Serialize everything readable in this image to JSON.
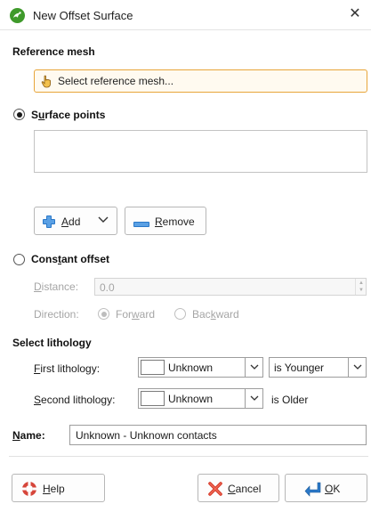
{
  "window": {
    "title": "New Offset Surface",
    "icon": "leapfrog-app-icon",
    "close_label": "✕"
  },
  "reference_mesh": {
    "heading": "Reference mesh",
    "button_label": "Select reference mesh...",
    "button_icon": "pointing-hand-icon"
  },
  "surface_points": {
    "radio_label_pre": "S",
    "radio_label_acc": "u",
    "radio_label_post": "rface points",
    "selected": true,
    "items": [],
    "add_label": "Add",
    "add_accel": "A",
    "remove_label": "Remove",
    "remove_accel": "R"
  },
  "constant_offset": {
    "radio_label_pre": "Cons",
    "radio_label_acc": "t",
    "radio_label_post": "ant offset",
    "selected": false,
    "distance_label_acc": "D",
    "distance_label_post": "istance:",
    "distance_value": "0.0",
    "direction_label": "Direction:",
    "forward_label": "Forward",
    "backward_label": "Backward",
    "forward_selected": true
  },
  "lithology": {
    "heading": "Select lithology",
    "first_label_acc": "F",
    "first_label_post": "irst lithology:",
    "first_value": "Unknown",
    "relation_value": "is Younger",
    "second_label_acc": "S",
    "second_label_post": "econd lithology:",
    "second_value": "Unknown",
    "second_relation": "is Older"
  },
  "name": {
    "label_acc": "N",
    "label_post": "ame:",
    "value": "Unknown - Unknown contacts"
  },
  "footer": {
    "help_label": "Help",
    "help_accel": "H",
    "cancel_label": "Cancel",
    "cancel_accel": "C",
    "ok_label": "OK",
    "ok_accel": "O"
  },
  "colors": {
    "accent_border": "#e8a53a",
    "add_icon": "#2a78c8",
    "remove_icon": "#2a78c8",
    "app_icon": "#3f9a2b",
    "cancel_icon": "#d63a2a"
  }
}
